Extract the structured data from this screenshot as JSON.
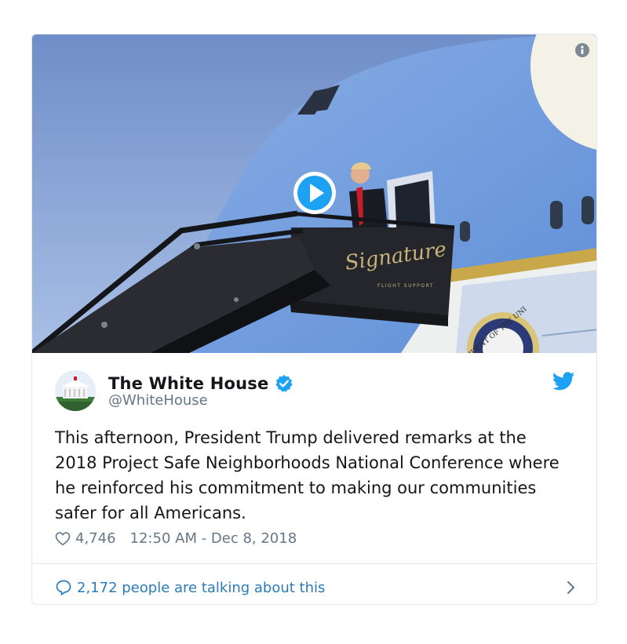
{
  "tweet": {
    "display_name": "The White House",
    "handle": "@WhiteHouse",
    "verified": true,
    "text": "This afternoon, President Trump delivered remarks at the 2018 Project Safe Neighborhoods National Conference where he reinforced his commitment to making our communities safer for all Americans.",
    "likes": "4,746",
    "timestamp": "12:50 AM - Dec 8, 2018",
    "conversation": "2,172 people are talking about this"
  },
  "media": {
    "signature_text": "Signature",
    "signature_sub": "FLIGHT SUPPORT",
    "seal_text": "SIDENT OF THE UNI",
    "play_icon": "play-icon",
    "info_icon": "info-icon"
  },
  "icons": {
    "verified": "verified-badge-icon",
    "brand": "twitter-bird-icon",
    "like": "heart-icon",
    "reply": "speech-bubble-icon",
    "more": "chevron-right-icon"
  },
  "colors": {
    "brand_blue": "#1da1f2",
    "link_blue": "#2b7bb9",
    "muted": "#657786",
    "text": "#14171a",
    "border": "#e1e8ed"
  }
}
